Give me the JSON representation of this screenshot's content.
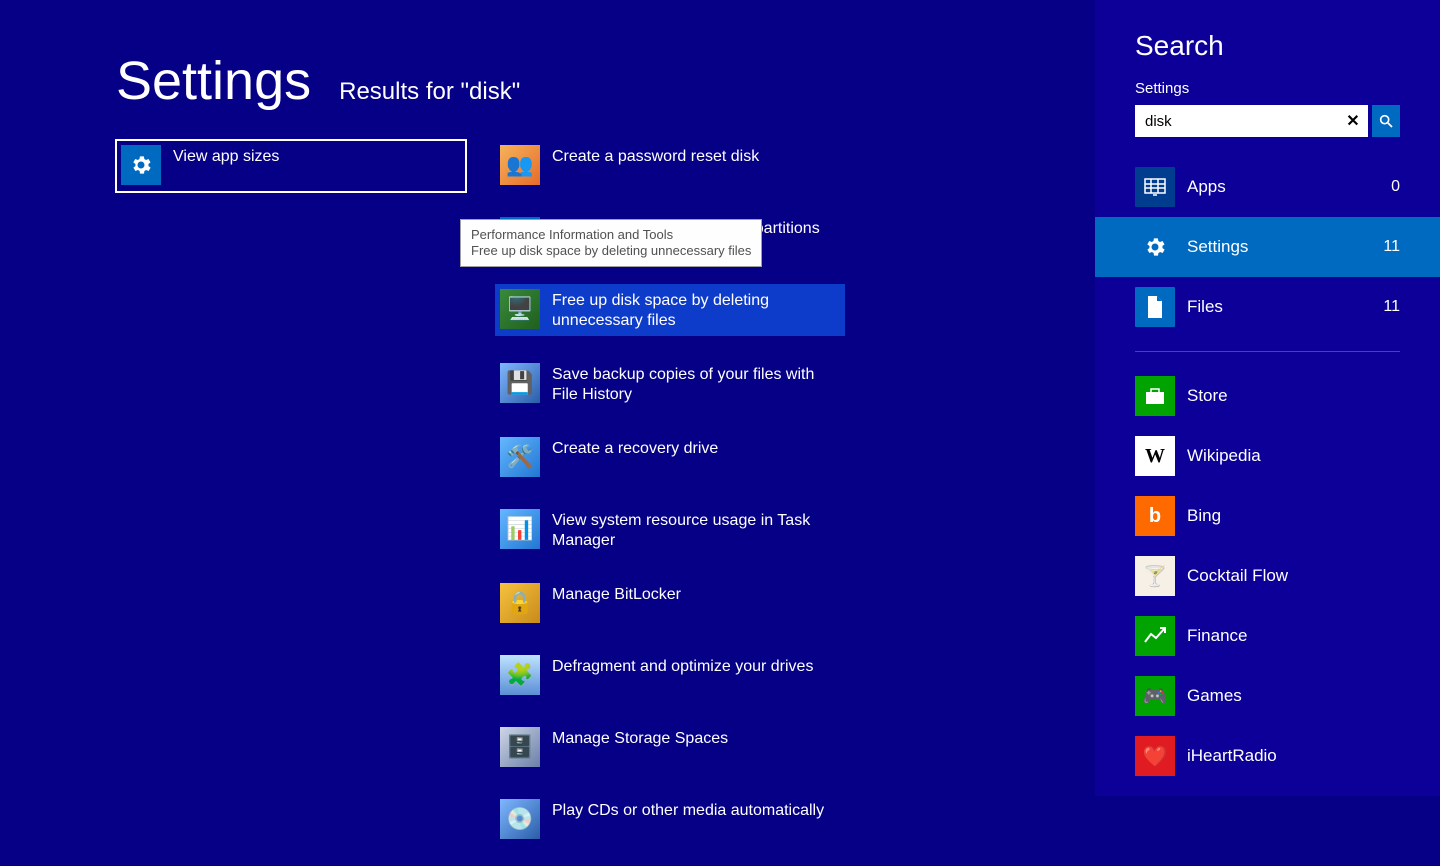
{
  "header": {
    "title": "Settings",
    "results_label": "Results for \"disk\""
  },
  "col1": [
    {
      "label": "View app sizes",
      "icon": "gear-icon",
      "selected": true
    }
  ],
  "col2": [
    {
      "label": "Create a password reset disk",
      "icon": "users-icon"
    },
    {
      "label": "Create and format hard disk partitions",
      "icon": "gear-icon"
    },
    {
      "label": "Free up disk space by deleting unnecessary files",
      "icon": "monitor-icon",
      "hovered": true
    },
    {
      "label": "Save backup copies of your files with File History",
      "icon": "history-drive-icon"
    },
    {
      "label": "Create a recovery drive",
      "icon": "recovery-icon"
    },
    {
      "label": "View system resource usage in Task Manager",
      "icon": "taskmgr-icon"
    },
    {
      "label": "Manage BitLocker",
      "icon": "bitlocker-icon"
    },
    {
      "label": "Defragment and optimize your drives",
      "icon": "defrag-icon"
    },
    {
      "label": "Manage Storage Spaces",
      "icon": "storage-icon"
    },
    {
      "label": "Play CDs or other media automatically",
      "icon": "autoplay-icon"
    }
  ],
  "tooltip": {
    "line1": "Performance Information and Tools",
    "line2": "Free up disk space by deleting unnecessary files"
  },
  "search": {
    "title": "Search",
    "scope": "Settings",
    "query": "disk",
    "categories": [
      {
        "label": "Apps",
        "count": 0,
        "icon": "apps-grid-icon",
        "bg": "bg-deepblue"
      },
      {
        "label": "Settings",
        "count": 11,
        "icon": "gear-icon",
        "bg": "bg-blue",
        "active": true
      },
      {
        "label": "Files",
        "count": 11,
        "icon": "file-icon",
        "bg": "bg-blue"
      }
    ],
    "apps": [
      {
        "label": "Store",
        "icon": "store-icon",
        "bg": "bg-green"
      },
      {
        "label": "Wikipedia",
        "icon": "wikipedia-icon",
        "bg": "bg-white",
        "glyph": "W"
      },
      {
        "label": "Bing",
        "icon": "bing-icon",
        "bg": "bg-orange",
        "glyph": "b"
      },
      {
        "label": "Cocktail Flow",
        "icon": "cocktail-icon",
        "bg": "bg-cream",
        "glyph": "🍸"
      },
      {
        "label": "Finance",
        "icon": "finance-icon",
        "bg": "bg-green",
        "glyph": "📈"
      },
      {
        "label": "Games",
        "icon": "games-icon",
        "bg": "bg-green",
        "glyph": "🎮"
      },
      {
        "label": "iHeartRadio",
        "icon": "iheartradio-icon",
        "bg": "bg-red",
        "glyph": "♥"
      }
    ]
  }
}
